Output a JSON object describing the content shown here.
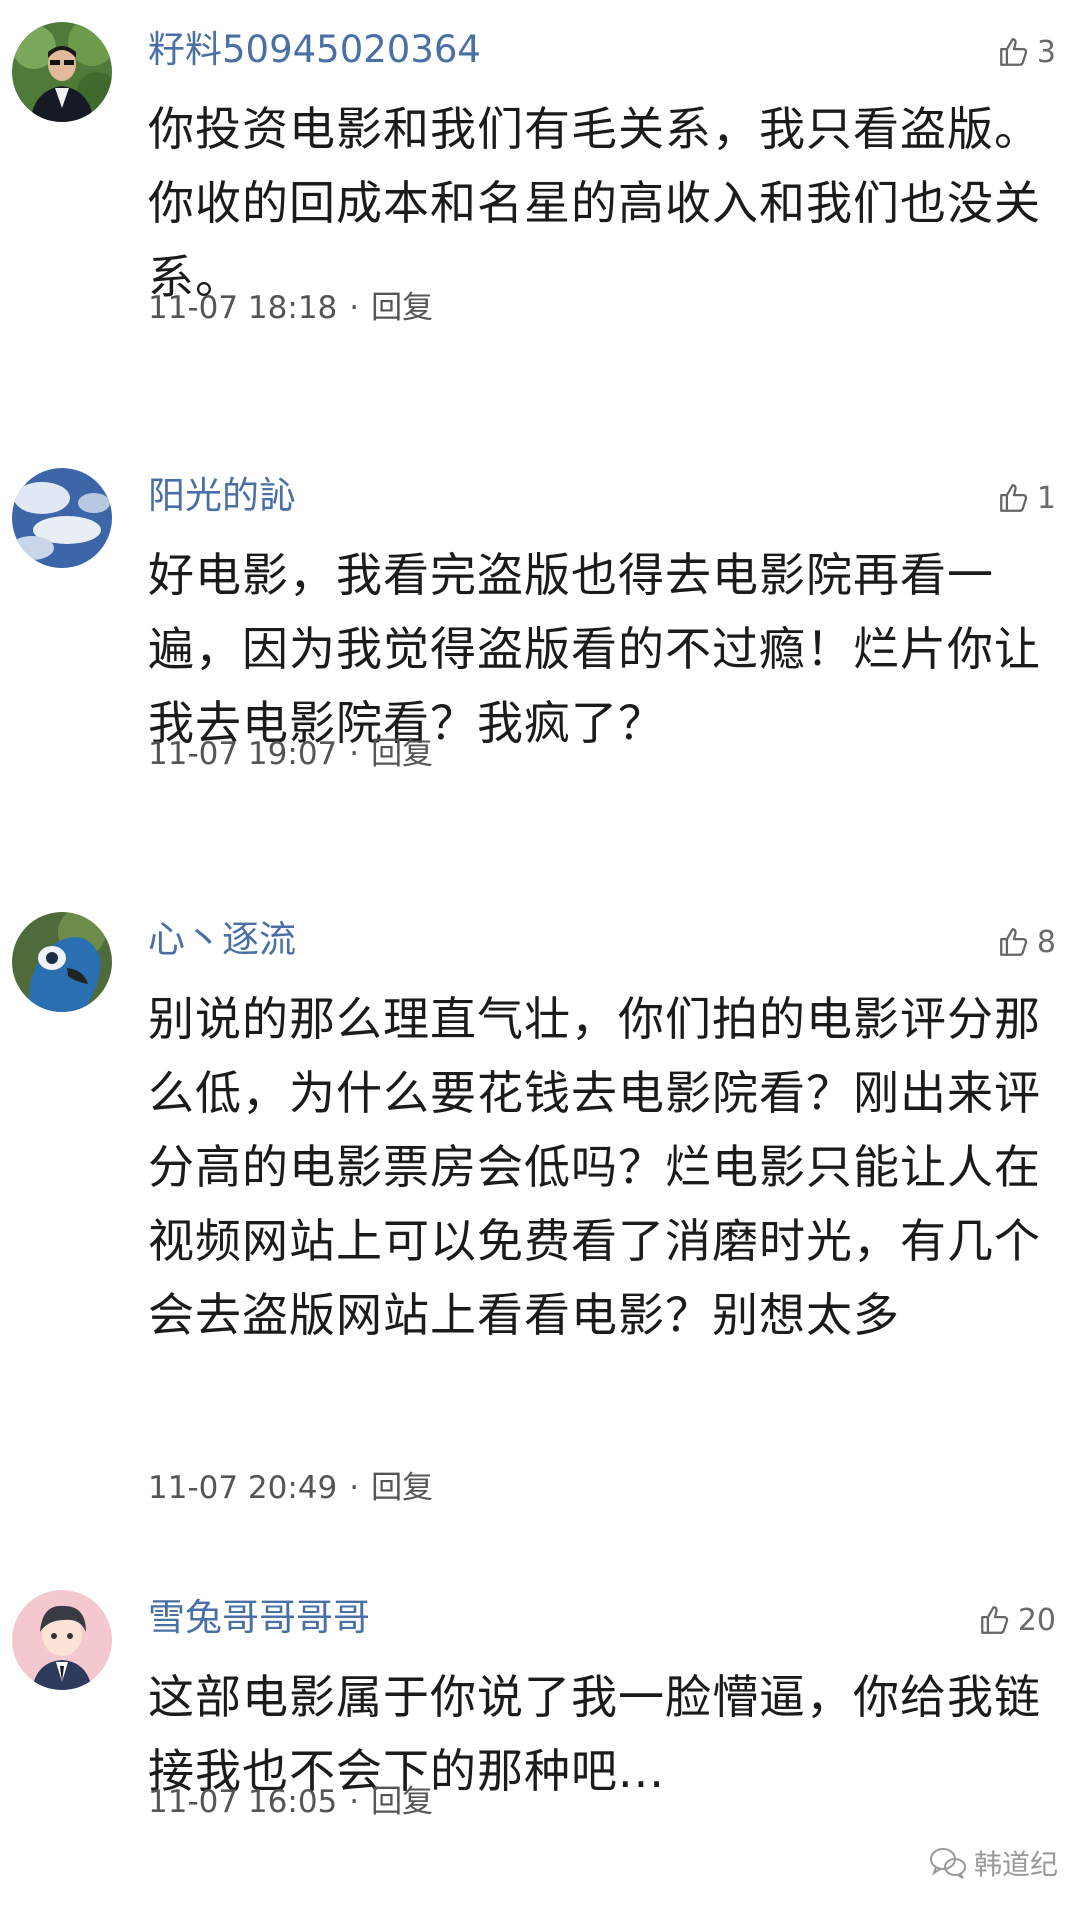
{
  "comments": [
    {
      "username": "籽料50945020364",
      "likes": "3",
      "text": "你投资电影和我们有毛关系，我只看盗版。你收的回成本和名星的高收入和我们也没关系。",
      "time": "11-07 18:18",
      "separator": "·",
      "reply": "回复"
    },
    {
      "username": "阳光的訫",
      "likes": "1",
      "text": "好电影，我看完盗版也得去电影院再看一遍，因为我觉得盗版看的不过瘾！烂片你让我去电影院看？我疯了？",
      "time": "11-07 19:07",
      "separator": "·",
      "reply": "回复"
    },
    {
      "username": "心丶逐流",
      "likes": "8",
      "text": "别说的那么理直气壮，你们拍的电影评分那么低，为什么要花钱去电影院看？刚出来评分高的电影票房会低吗？烂电影只能让人在视频网站上可以免费看了消磨时光，有几个会去盗版网站上看看电影？别想太多",
      "time": "11-07 20:49",
      "separator": "·",
      "reply": "回复"
    },
    {
      "username": "雪兔哥哥哥哥",
      "likes": "20",
      "text": "这部电影属于你说了我一脸懵逼，你给我链接我也不会下的那种吧...",
      "time": "11-07 16:05",
      "separator": "·",
      "reply": "回复"
    }
  ],
  "watermark": "韩道纪",
  "colors": {
    "username": "#4a6fa5",
    "text": "#1b1b1b",
    "meta": "#555555"
  }
}
